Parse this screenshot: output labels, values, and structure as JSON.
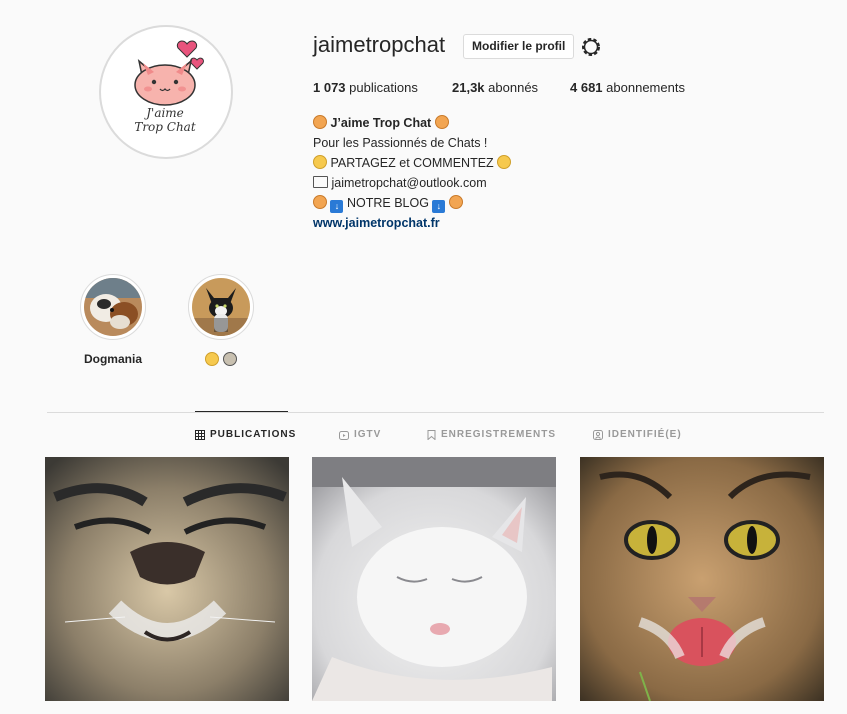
{
  "profile": {
    "username": "jaimetropchat",
    "edit_profile_label": "Modifier le profil",
    "stats": [
      {
        "value": "1 073",
        "label": "publications"
      },
      {
        "value": "21,3k",
        "label": "abonnés"
      },
      {
        "value": "4 681",
        "label": "abonnements"
      }
    ],
    "avatar_text": [
      "J'aime",
      "Trop Chat"
    ],
    "bio": {
      "name": "J’aime Trop Chat",
      "line1": "Pour les Passionnés de Chats !",
      "line2": "PARTAGEZ et COMMENTEZ",
      "email": "jaimetropchat@outlook.com",
      "blog": "NOTRE BLOG",
      "link": "www.jaimetropchat.fr"
    }
  },
  "highlights": [
    {
      "label": "Dogmania",
      "icon": "dog-photo"
    },
    {
      "label": "",
      "icon": "cat-photo"
    }
  ],
  "tabs": [
    {
      "label": "PUBLICATIONS",
      "icon": "grid-icon",
      "active": true
    },
    {
      "label": "IGTV",
      "icon": "igtv-icon",
      "active": false
    },
    {
      "label": "ENREGISTREMENTS",
      "icon": "bookmark-icon",
      "active": false
    },
    {
      "label": "IDENTIFIÉ(E)",
      "icon": "tag-icon",
      "active": false
    }
  ],
  "colors": {
    "background": "#fafafa",
    "border": "#dbdbdb",
    "text": "#262626",
    "muted": "#999999",
    "link": "#003569"
  }
}
